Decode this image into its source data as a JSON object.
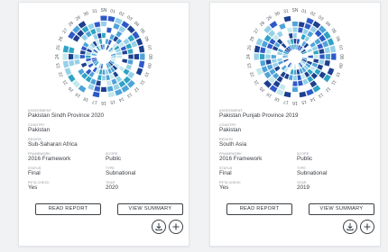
{
  "colors": {
    "accent": "#2f4cb5",
    "palette": [
      "#1c3f8e",
      "#2d59c8",
      "#4ea3d8",
      "#95d0e8",
      "#c4e8ec",
      "#2ea3c3"
    ]
  },
  "cards": [
    {
      "wheel_numbers": [
        "SN",
        "01",
        "02",
        "03",
        "04",
        "05",
        "06",
        "07",
        "08",
        "09",
        "10",
        "11",
        "12",
        "13",
        "14",
        "15",
        "16",
        "17",
        "18",
        "19",
        "20",
        "21",
        "22",
        "23",
        "24",
        "25",
        "26",
        "27",
        "28",
        "29",
        "30",
        "31"
      ],
      "assessment_label": "ASSESSMENT",
      "assessment": "Pakistan Sindh Province 2020",
      "country_label": "COUNTRY",
      "country": "Pakistan",
      "region_label": "REGION",
      "region": "Sub-Saharan Africa",
      "framework_label": "FRAMEWORK",
      "framework": "2016 Framework",
      "scope_label": "SCOPE",
      "scope": "Public",
      "status_label": "STATUS",
      "status": "Final",
      "type_label": "TYPE",
      "type": "Subnational",
      "peta_label": "PETA CHECK",
      "peta": "Yes",
      "year_label": "YEAR",
      "year": "2020",
      "read_report": "READ REPORT",
      "view_summary": "VIEW SUMMARY"
    },
    {
      "wheel_numbers": [
        "SN",
        "01",
        "02",
        "03",
        "04",
        "05",
        "06",
        "07",
        "08",
        "09",
        "10",
        "11",
        "12",
        "13",
        "14",
        "15",
        "16",
        "17",
        "18",
        "19",
        "20",
        "21",
        "22",
        "23",
        "24",
        "25",
        "26",
        "27",
        "28",
        "29",
        "30",
        "31"
      ],
      "assessment_label": "ASSESSMENT",
      "assessment": "Pakistan Punjab Province 2019",
      "country_label": "COUNTRY",
      "country": "Pakistan",
      "region_label": "REGION",
      "region": "South Asia",
      "framework_label": "FRAMEWORK",
      "framework": "2016 Framework",
      "scope_label": "SCOPE",
      "scope": "Public",
      "status_label": "STATUS",
      "status": "Final",
      "type_label": "TYPE",
      "type": "Subnational",
      "peta_label": "PETA CHECK",
      "peta": "Yes",
      "year_label": "YEAR",
      "year": "2019",
      "read_report": "READ REPORT",
      "view_summary": "VIEW SUMMARY"
    }
  ]
}
